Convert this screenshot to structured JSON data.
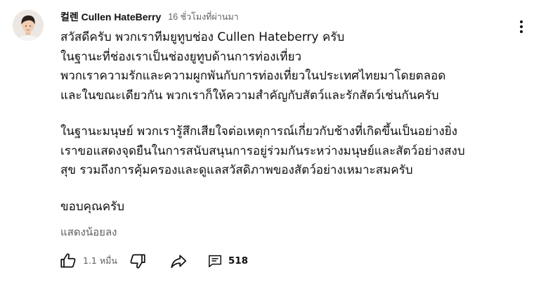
{
  "comment": {
    "author": "컬렌 Cullen HateBerry",
    "time": "16 ชั่วโมงที่ผ่านมา",
    "lines": [
      "สวัสดีครับ พวกเราทีมยูทูบช่อง Cullen Hateberry ครับ",
      "ในฐานะที่ช่องเราเป็นช่องยูทูบด้านการท่องเที่ยว",
      "พวกเราความรักและความผูกพันกับการท่องเที่ยวในประเทศไทยมาโดยตลอด",
      "และในขณะเดียวกัน พวกเราก็ให้ความสำคัญกับสัตว์และรักสัตว์เช่นกันครับ",
      "ในฐานะมนุษย์ พวกเรารู้สึกเสียใจต่อเหตุการณ์เกี่ยวกับช้างที่เกิดขึ้นเป็นอย่างยิ่ง",
      "เราขอแสดงจุดยืนในการสนับสนุนการอยู่ร่วมกันระหว่างมนุษย์และสัตว์อย่างสงบ",
      "สุข รวมถึงการคุ้มครองและดูแลสวัสดิภาพของสัตว์อย่างเหมาะสมครับ",
      "ขอบคุณครับ"
    ],
    "show_less": "แสดงน้อยลง"
  },
  "actions": {
    "like_count": "1.1 หมื่น",
    "reply_count": "518"
  },
  "icons": {
    "more": "more-vert-icon",
    "like": "thumb-up-icon",
    "dislike": "thumb-down-icon",
    "share": "share-icon",
    "replies": "comment-icon"
  },
  "colors": {
    "text": "#0f0f0f",
    "secondary": "#606060",
    "background": "#ffffff"
  }
}
